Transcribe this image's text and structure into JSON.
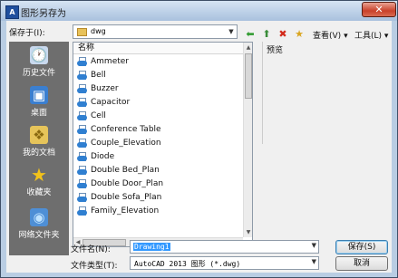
{
  "window": {
    "title": "图形另存为",
    "app_icon_glyph": "A",
    "close_glyph": "✕"
  },
  "save_in": {
    "label": "保存于(I):",
    "value": "dwg",
    "arrow": "▼"
  },
  "toolbar": {
    "back_glyph": "⬅",
    "up_glyph": "⬆",
    "delete_glyph": "✖",
    "new_folder_glyph": "★",
    "view_label": "查看(V)",
    "tools_label": "工具(L)",
    "dropdown_glyph": "▾"
  },
  "places": [
    {
      "label": "历史文件",
      "glyph": "🕐"
    },
    {
      "label": "桌面",
      "glyph": "▣"
    },
    {
      "label": "我的文档",
      "glyph": "❖"
    },
    {
      "label": "收藏夹",
      "glyph": "★"
    },
    {
      "label": "网络文件夹",
      "glyph": "◉"
    }
  ],
  "file_list": {
    "column_header": "名称",
    "items": [
      "Ammeter",
      "Bell",
      "Buzzer",
      "Capacitor",
      "Cell",
      "Conference Table",
      "Couple_Elevation",
      "Diode",
      "Double Bed_Plan",
      "Double Door_Plan",
      "Double Sofa_Plan",
      "Family_Elevation"
    ]
  },
  "preview": {
    "label": "预览"
  },
  "filename": {
    "label": "文件名(N):",
    "value": "Drawing1"
  },
  "filetype": {
    "label": "文件类型(T):",
    "value": "AutoCAD 2013 图形 (*.dwg)"
  },
  "buttons": {
    "save": "保存(S)",
    "cancel": "取消"
  },
  "colors": {
    "title_gradient_top": "#d6e4f3",
    "places_bg": "#6e6e6e",
    "close_red": "#c9412a",
    "file_icon_blue": "#2f7fd1"
  }
}
